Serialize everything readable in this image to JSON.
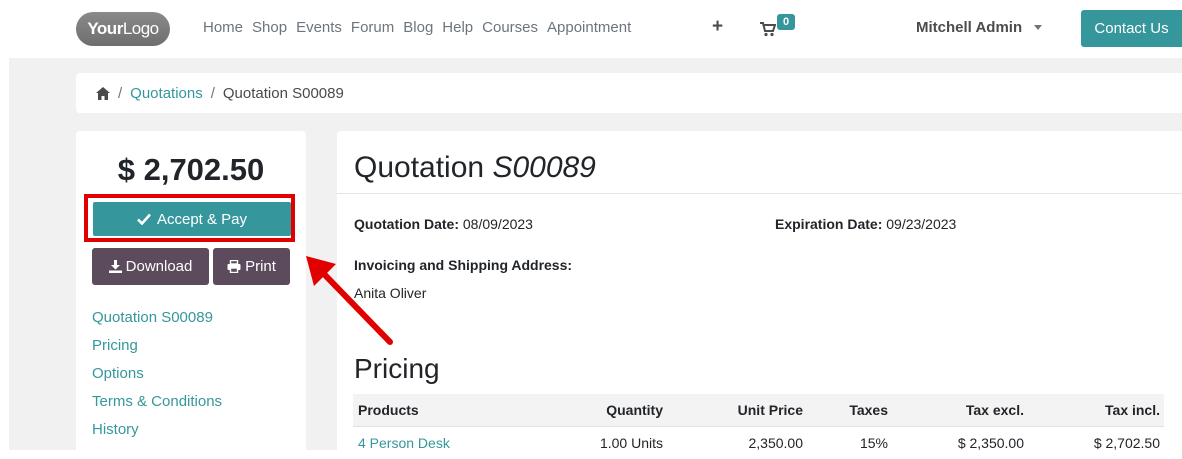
{
  "navbar": {
    "logo": {
      "part1": "Your",
      "part2": "Logo"
    },
    "links": [
      "Home",
      "Shop",
      "Events",
      "Forum",
      "Blog",
      "Help",
      "Courses",
      "Appointment"
    ],
    "plus_label": "+",
    "cart_count": "0",
    "user_name": "Mitchell Admin",
    "contact_label": "Contact Us"
  },
  "breadcrumb": {
    "sep": "/",
    "link": "Quotations",
    "current": "Quotation S00089"
  },
  "sidebar": {
    "total": "$ 2,702.50",
    "accept_label": "Accept & Pay",
    "download_label": "Download",
    "print_label": "Print",
    "toc": [
      "Quotation S00089",
      "Pricing",
      "Options",
      "Terms & Conditions",
      "History"
    ]
  },
  "quotation": {
    "title_prefix": "Quotation",
    "number": "S00089",
    "date_label": "Quotation Date:",
    "date_value": "08/09/2023",
    "expiration_label": "Expiration Date:",
    "expiration_value": "09/23/2023",
    "address_label": "Invoicing and Shipping Address:",
    "address_name": "Anita Oliver"
  },
  "pricing": {
    "heading": "Pricing",
    "columns": [
      "Products",
      "Quantity",
      "Unit Price",
      "Taxes",
      "Tax excl.",
      "Tax incl."
    ],
    "rows": [
      {
        "product": "4 Person Desk",
        "quantity": "1.00 Units",
        "unit_price": "2,350.00",
        "taxes": "15%",
        "tax_excl": "$ 2,350.00",
        "tax_incl": "$ 2,702.50"
      }
    ]
  },
  "colors": {
    "primary": "#35979c",
    "secondary": "#5c4a5d",
    "highlight": "#e00000"
  }
}
